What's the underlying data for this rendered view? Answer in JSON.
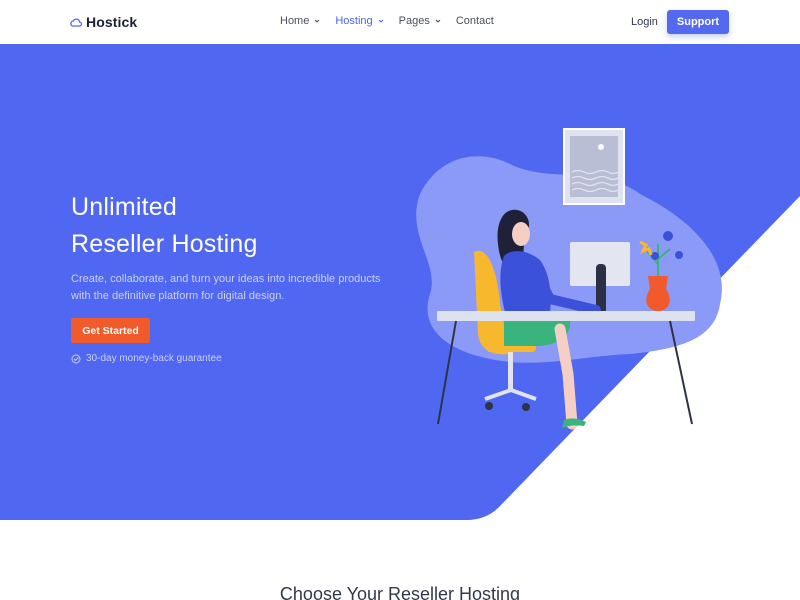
{
  "brand": {
    "name": "Hostick",
    "accent": "#5468f0",
    "hero_bg": "#4f66f0",
    "cta_color": "#f15a2b"
  },
  "nav": {
    "items": [
      {
        "label": "Home",
        "has_dropdown": true
      },
      {
        "label": "Hosting",
        "has_dropdown": true,
        "active": true
      },
      {
        "label": "Pages",
        "has_dropdown": true
      },
      {
        "label": "Contact",
        "has_dropdown": false
      }
    ],
    "login_label": "Login",
    "support_label": "Support"
  },
  "hero": {
    "title_line1": "Unlimited",
    "title_line2": "Reseller Hosting",
    "description": "Create, collaborate, and turn your ideas into incredible products with the definitive platform for digital design.",
    "cta_label": "Get Started",
    "guarantee": "30-day money-back guarantee"
  },
  "section": {
    "title": "Choose Your Reseller Hosting"
  }
}
